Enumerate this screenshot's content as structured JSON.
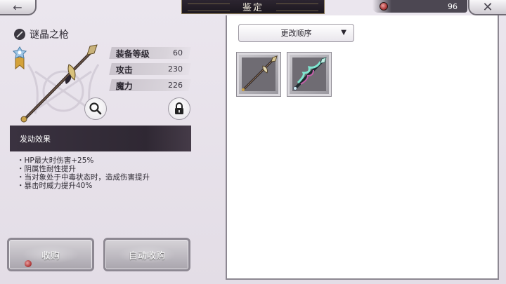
{
  "header": {
    "back_icon": "arrow-left-icon",
    "title": "鉴定",
    "currency_icon": "gem-coin-icon",
    "currency_value": "96",
    "close_icon": "close-icon"
  },
  "item": {
    "name": "谜晶之枪",
    "type_icon": "spear-type-icon",
    "stats": [
      {
        "label": "装备等级",
        "value": "60"
      },
      {
        "label": "攻击",
        "value": "230"
      },
      {
        "label": "魔力",
        "value": "226"
      }
    ],
    "effect_title": "发动效果",
    "effects": [
      "HP最大时伤害+25%",
      "阴属性耐性提升",
      "当对象处于中毒状态时，造成伤害提升",
      "暴击时威力提升40%"
    ]
  },
  "actions": {
    "collect_label": "收购",
    "auto_collect_label": "自动收购"
  },
  "inventory": {
    "sort_label": "更改顺序",
    "sort_arrow": "▼",
    "items": [
      {
        "name": "spear-dark"
      },
      {
        "name": "spear-crystal"
      }
    ]
  },
  "colors": {
    "accent_dark": "#2f2833",
    "background": "#e8e3ea",
    "title_text": "#f2ecdc"
  }
}
